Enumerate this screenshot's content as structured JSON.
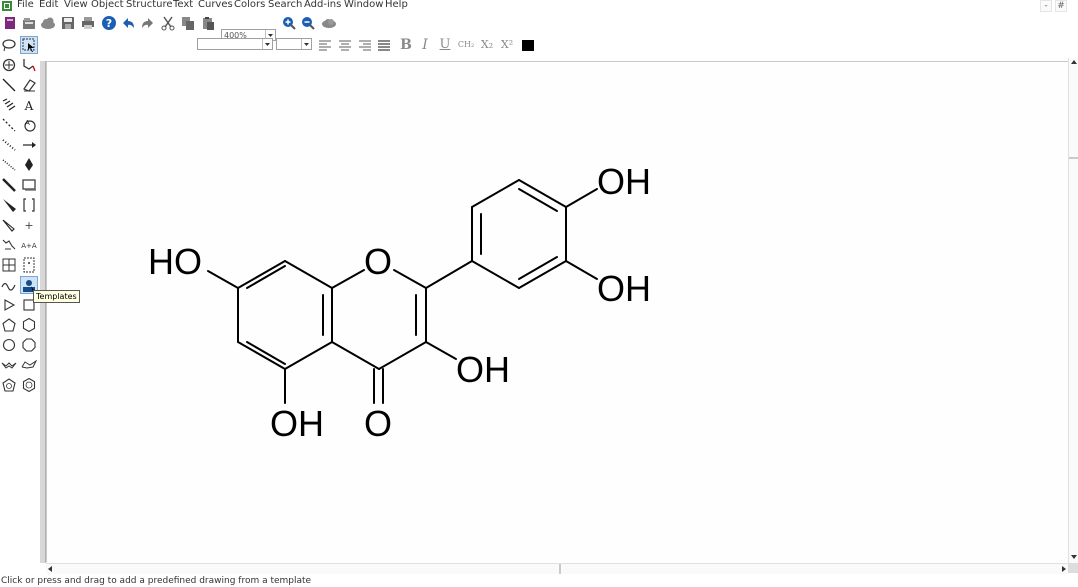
{
  "menu": {
    "items": [
      "File",
      "Edit",
      "View",
      "Object",
      "Structure",
      "Text",
      "Curves",
      "Colors",
      "Search",
      "Add-ins",
      "Window",
      "Help"
    ]
  },
  "window_controls": {
    "minimize": "-",
    "restore": "#"
  },
  "toolbar": {
    "zoom_value": "400%",
    "buttons": [
      "new-icon",
      "open-icon",
      "cloud-open-icon",
      "save-icon",
      "print-icon",
      "help-icon",
      "undo-icon",
      "redo-icon",
      "cut-icon",
      "copy-icon",
      "paste-icon",
      "zoom-in-icon",
      "zoom-out-icon",
      "zoom-fit-icon"
    ]
  },
  "text_toolbar": {
    "font_name": "",
    "font_size": "",
    "buttons": [
      "align-left-icon",
      "align-center-icon",
      "align-right-icon",
      "justify-icon",
      "bold-icon",
      "italic-icon",
      "underline-icon",
      "chemical-formula-icon",
      "subscript-icon",
      "superscript-icon",
      "text-color-icon"
    ],
    "bold": "B",
    "italic": "I",
    "underline": "U",
    "formula": "CH₂",
    "subscript": "X₂",
    "superscript": "X²",
    "text_color": "#000000"
  },
  "tooltip": {
    "text": "Templates"
  },
  "status": {
    "text": "Click or press and drag to add a predefined drawing from a template"
  },
  "drawing": {
    "labels": {
      "oh_top_right": "OH",
      "oh_right": "OH",
      "ho_left": "HO",
      "o_ring": "O",
      "oh_3": "OH",
      "oh_bottom": "OH",
      "o_carbonyl": "O"
    }
  }
}
